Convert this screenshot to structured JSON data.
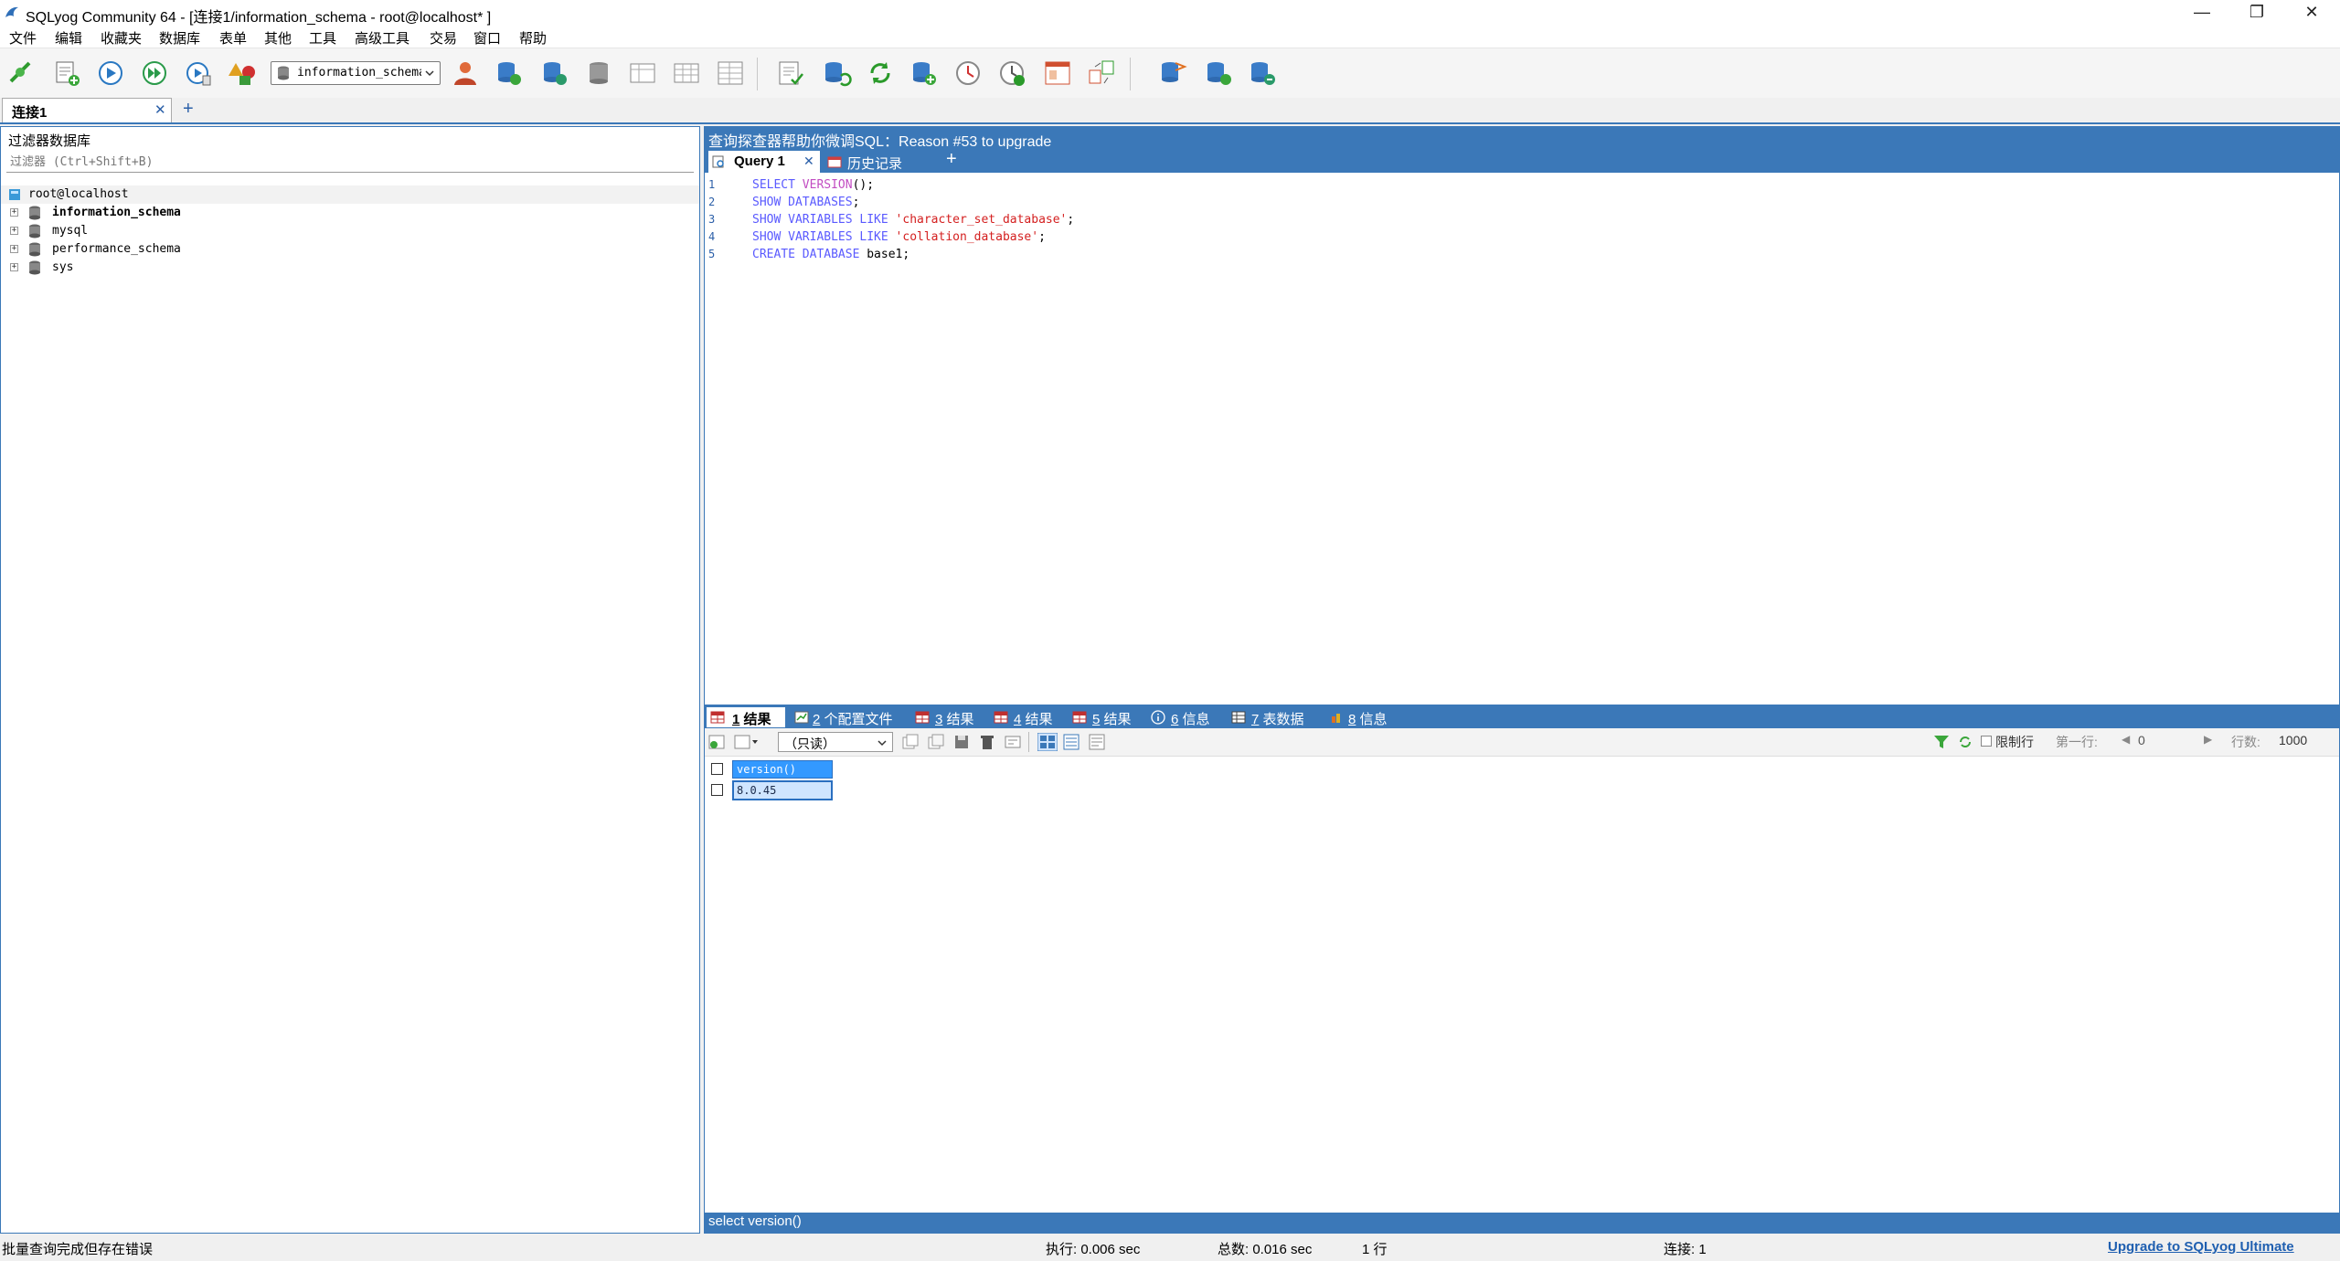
{
  "window": {
    "title": "SQLyog Community 64 - [连接1/information_schema - root@localhost* ]",
    "minimize": "—",
    "maximize": "❐",
    "close": "✕"
  },
  "menu": [
    "文件",
    "编辑",
    "收藏夹",
    "数据库",
    "表单",
    "其他",
    "工具",
    "高级工具",
    "交易",
    "窗口",
    "帮助"
  ],
  "toolbar": {
    "db_selected": "information_schema"
  },
  "connection_tabs": {
    "tab1": "连接1",
    "close": "✕",
    "add": "+"
  },
  "object_browser": {
    "title": "过滤器数据库",
    "filter_placeholder": "过滤器 (Ctrl+Shift+B)",
    "root": "root@localhost",
    "databases": [
      "information_schema",
      "mysql",
      "performance_schema",
      "sys"
    ],
    "expander": "+"
  },
  "editor": {
    "banner": "查询探查器帮助你微调SQL：Reason #53 to upgrade",
    "tab_query": "Query 1",
    "tab_close": "✕",
    "tab_history": "历史记录",
    "tab_add": "+",
    "line_numbers": [
      "1",
      "2",
      "3",
      "4",
      "5"
    ],
    "lines": [
      {
        "kw": "SELECT ",
        "fn": "VERSION",
        "rest": "();"
      },
      {
        "kw": "SHOW DATABASES",
        "rest": ";"
      },
      {
        "kw": "SHOW VARIABLES LIKE ",
        "str": "'character_set_database'",
        "rest": ";"
      },
      {
        "kw": "SHOW VARIABLES LIKE ",
        "str": "'collation_database'",
        "rest": ";"
      },
      {
        "kw": "CREATE DATABASE ",
        "rest": "base1;"
      }
    ]
  },
  "results": {
    "tabs": [
      {
        "num": "1",
        "label": "结果"
      },
      {
        "num": "2",
        "label": "个配置文件"
      },
      {
        "num": "3",
        "label": "结果"
      },
      {
        "num": "4",
        "label": "结果"
      },
      {
        "num": "5",
        "label": "结果"
      },
      {
        "num": "6",
        "label": "信息"
      },
      {
        "num": "7",
        "label": "表数据"
      },
      {
        "num": "8",
        "label": "信息"
      }
    ],
    "mode": "（只读）",
    "limit_label": "限制行",
    "first_row_label": "第一行:",
    "first_row_value": "0",
    "rows_label": "行数:",
    "rows_value": "1000",
    "column_header": "version()",
    "cell_value": "8.0.45",
    "status_line": "select version()"
  },
  "statusbar": {
    "message": "批量查询完成但存在错误",
    "exec": "执行: 0.006 sec",
    "total": "总数: 0.016 sec",
    "rows": "1 行",
    "connection": "连接: 1",
    "upgrade": "Upgrade to SQLyog Ultimate"
  },
  "colors": {
    "accent": "#3b78b8",
    "selection": "#3399ff"
  }
}
